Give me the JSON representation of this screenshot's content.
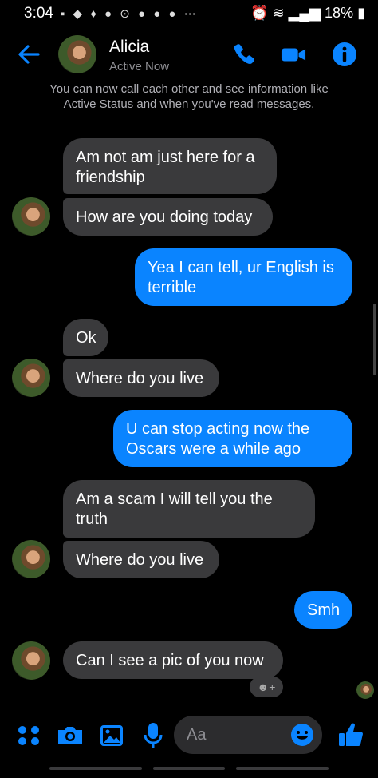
{
  "status_bar": {
    "time": "3:04",
    "notif_icons": "▪ ◆ ♦ ● ⊙ ● ● ● ⋯",
    "battery": "18%"
  },
  "header": {
    "name": "Alicia",
    "status": "Active Now"
  },
  "notice": "You can now call each other and see information like Active Status and when you've read messages.",
  "messages": [
    {
      "side": "in",
      "text": "Am not am just here for a friendship"
    },
    {
      "side": "in",
      "text": "How are you doing today"
    },
    {
      "side": "out",
      "text": "Yea I can tell, ur English is terrible"
    },
    {
      "side": "in",
      "text": "Ok"
    },
    {
      "side": "in",
      "text": "Where do you live"
    },
    {
      "side": "out",
      "text": "U can stop acting now the Oscars were a while ago"
    },
    {
      "side": "in",
      "text": "Am a scam I will tell you the truth"
    },
    {
      "side": "in",
      "text": "Where do you live"
    },
    {
      "side": "out",
      "text": "Smh"
    },
    {
      "side": "in",
      "text": "Can I see a pic of you now"
    }
  ],
  "composer": {
    "placeholder": "Aa"
  },
  "colors": {
    "accent": "#0a84ff",
    "incoming_bubble": "#3a3a3c",
    "background": "#000000"
  }
}
